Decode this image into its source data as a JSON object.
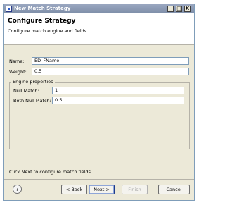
{
  "window": {
    "title": "New Match Strategy",
    "controls": {
      "minimize": "_",
      "maximize": "□",
      "close": "X"
    }
  },
  "header": {
    "title": "Configure Strategy",
    "subtitle": "Configure match engine and fields"
  },
  "form": {
    "name_label": "Name:",
    "name_value": "ED_FName",
    "weight_label": "Weight:",
    "weight_value": "0.5"
  },
  "engine": {
    "group_label": "Engine properties",
    "null_match_label": "Null Match:",
    "null_match_value": "1",
    "both_null_match_label": "Both Null Match:",
    "both_null_match_value": "0.5"
  },
  "status": {
    "message": "Click Next to configure match fields."
  },
  "footer": {
    "help_glyph": "?",
    "back_label": "< Back",
    "next_label": "Next >",
    "finish_label": "Finish",
    "cancel_label": "Cancel"
  }
}
